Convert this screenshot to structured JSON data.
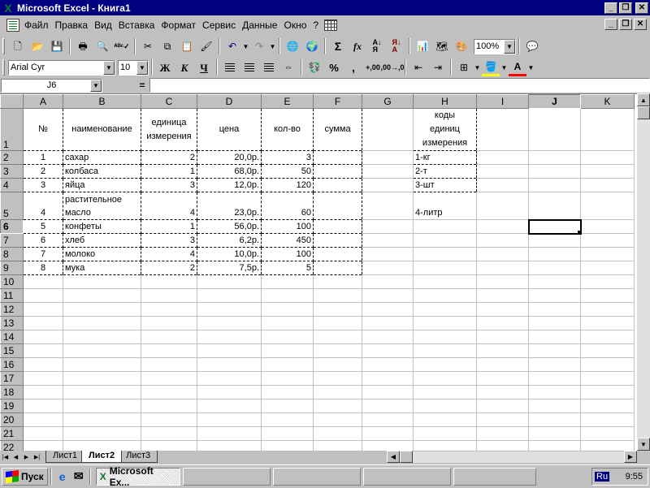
{
  "window": {
    "title": "Microsoft Excel - Книга1",
    "app_icon": "excel-x-icon",
    "buttons": [
      "_",
      "🗗",
      "✕"
    ]
  },
  "menu": {
    "items": [
      "Файл",
      "Правка",
      "Вид",
      "Вставка",
      "Формат",
      "Сервис",
      "Данные",
      "Окно",
      "?"
    ]
  },
  "toolbar_standard": {
    "zoom": "100%"
  },
  "toolbar_format": {
    "font": "Arial Cyr",
    "size": "10",
    "bold": "Ж",
    "italic": "К",
    "underline": "Ч",
    "percent": "%",
    "comma": ",",
    "inc_decimal": "+,00",
    "dec_decimal": ",00→,0"
  },
  "formula_bar": {
    "name_box": "J6",
    "equals": "=",
    "value": ""
  },
  "columns": [
    "A",
    "B",
    "C",
    "D",
    "E",
    "F",
    "G",
    "H",
    "I",
    "J",
    "K"
  ],
  "active_column": "J",
  "active_row": 6,
  "table": {
    "headers": {
      "a": "№",
      "b": "наименование",
      "c1": "единица",
      "c2": "измерения",
      "d": "цена",
      "e": "кол-во",
      "f": "сумма",
      "h1": "коды",
      "h2": "единиц",
      "h3": "измерения"
    },
    "rows": [
      {
        "a": "1",
        "b": "сахар",
        "c": "2",
        "d": "20,0р.",
        "e": "3",
        "f": "",
        "h": "1-кг"
      },
      {
        "a": "2",
        "b": "колбаса",
        "c": "1",
        "d": "68,0р.",
        "e": "50",
        "f": "",
        "h": "2-т"
      },
      {
        "a": "3",
        "b": "яйца",
        "c": "3",
        "d": "12,0р.",
        "e": "120",
        "f": "",
        "h": "3-шт"
      },
      {
        "a": "4",
        "b1": "растительное",
        "b": "масло",
        "c": "4",
        "d": "23,0р.",
        "e": "60",
        "f": "",
        "h": "4-литр"
      },
      {
        "a": "5",
        "b": "конфеты",
        "c": "1",
        "d": "56,0р.",
        "e": "100",
        "f": "",
        "h": ""
      },
      {
        "a": "6",
        "b": "хлеб",
        "c": "3",
        "d": "6,2р.",
        "e": "450",
        "f": "",
        "h": ""
      },
      {
        "a": "7",
        "b": "молоко",
        "c": "4",
        "d": "10,0р.",
        "e": "100",
        "f": "",
        "h": ""
      },
      {
        "a": "8",
        "b": "мука",
        "c": "2",
        "d": "7,5р.",
        "e": "5",
        "f": "",
        "h": ""
      }
    ]
  },
  "row_numbers": [
    "1",
    "2",
    "3",
    "4",
    "5",
    "6",
    "7",
    "8",
    "9",
    "10",
    "11",
    "12",
    "13",
    "14",
    "15",
    "16",
    "17",
    "18",
    "19",
    "20",
    "21",
    "22"
  ],
  "sheets": {
    "tabs": [
      "Лист1",
      "Лист2",
      "Лист3"
    ],
    "active": "Лист2"
  },
  "taskbar": {
    "start": "Пуск",
    "task": "Microsoft Ex...",
    "lang": "Ru",
    "clock": "9:55"
  }
}
